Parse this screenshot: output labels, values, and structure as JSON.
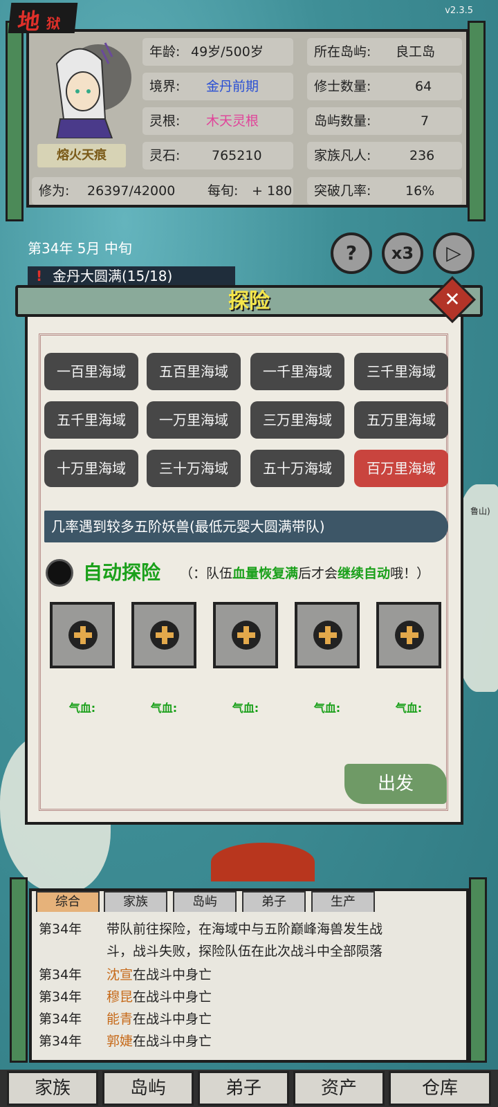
{
  "header": {
    "mode_label": "地",
    "mode_sub": "狱",
    "version": "v2.3.5"
  },
  "character": {
    "title": "熔火天痕",
    "age_label": "年龄:",
    "age_value": "49岁/500岁",
    "realm_label": "境界:",
    "realm_value": "金丹前期",
    "root_label": "灵根:",
    "root_value": "木天灵根",
    "stone_label": "灵石:",
    "stone_value": "765210",
    "cult_label": "修为:",
    "cult_value": "26397/42000",
    "per_label": "每旬:",
    "per_value": "+ 180",
    "island_label": "所在岛屿:",
    "island_value": "良工岛",
    "cult_count_label": "修士数量:",
    "cult_count_value": "64",
    "island_count_label": "岛屿数量:",
    "island_count_value": "7",
    "mortals_label": "家族凡人:",
    "mortals_value": "236",
    "break_label": "突破几率:",
    "break_value": "16%"
  },
  "time": {
    "date": "第34年 5月 中旬",
    "goal": "金丹大圆满(15/18)",
    "speed": "x3",
    "help": "?",
    "play": "▷"
  },
  "explore": {
    "title": "探险",
    "close": "✕",
    "regions": [
      "一百里海域",
      "五百里海域",
      "一千里海域",
      "三千里海域",
      "五千里海域",
      "一万里海域",
      "三万里海域",
      "五万里海域",
      "十万里海域",
      "三十万海域",
      "五十万海域",
      "百万里海域"
    ],
    "description": "几率遇到较多五阶妖兽(最低元婴大圆满带队)",
    "auto_label": "自动探险",
    "note_a": "（：队伍",
    "note_b": "血量恢复满",
    "note_c": "后才会",
    "note_d": "继续自动",
    "note_e": "哦！）",
    "hp_label": "气血:",
    "go": "出发"
  },
  "log": {
    "tabs": [
      "综合",
      "家族",
      "岛屿",
      "弟子",
      "生产"
    ],
    "line1_year": "第34年",
    "line1_text": "带队前往探险，在海域中与五阶巅峰海兽发生战",
    "line1_cont": "斗，战斗失败，探险队伍在此次战斗中全部陨落",
    "deaths": [
      {
        "year": "第34年",
        "name": "沈宣",
        "text": "在战斗中身亡"
      },
      {
        "year": "第34年",
        "name": "穆昆",
        "text": "在战斗中身亡"
      },
      {
        "year": "第34年",
        "name": "能青",
        "text": "在战斗中身亡"
      },
      {
        "year": "第34年",
        "name": "郭婕",
        "text": "在战斗中身亡"
      }
    ]
  },
  "nav": [
    "家族",
    "岛屿",
    "弟子",
    "资产",
    "仓库"
  ],
  "colors": {
    "realm": "#2a4fd4",
    "root": "#e0449a",
    "selected_region": "#c9443e",
    "green": "#1aa01a"
  }
}
